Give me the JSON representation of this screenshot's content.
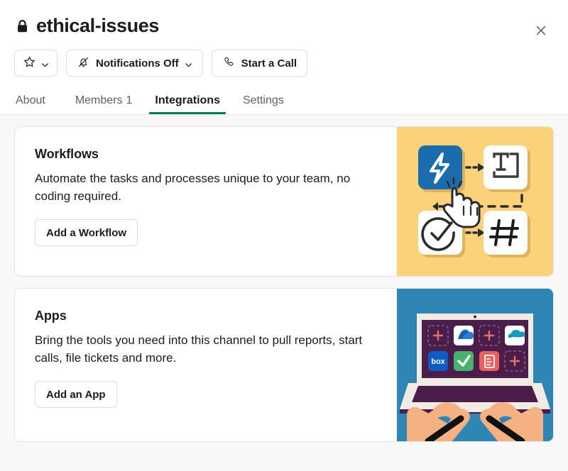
{
  "header": {
    "channel_name": "ethical-issues",
    "lock_icon": "lock-icon",
    "close_icon": "close-icon"
  },
  "toolbar": {
    "star_button": {
      "label": "",
      "icon": "star-icon",
      "chevron": "chevron-down-icon"
    },
    "notifications_button": {
      "label": "Notifications Off",
      "icon": "bell-muted-icon",
      "chevron": "chevron-down-icon"
    },
    "call_button": {
      "label": "Start a Call",
      "icon": "phone-icon"
    }
  },
  "tabs": [
    {
      "label": "About",
      "count": "",
      "active": false
    },
    {
      "label": "Members",
      "count": "1",
      "active": false
    },
    {
      "label": "Integrations",
      "count": "",
      "active": true
    },
    {
      "label": "Settings",
      "count": "",
      "active": false
    }
  ],
  "cards": [
    {
      "title": "Workflows",
      "description": "Automate the tasks and processes unique to your team, no coding required.",
      "button_label": "Add a Workflow",
      "art": "workflow-builder-illustration",
      "art_background": "#FBD17A",
      "art_tiles": [
        "lightning-bolt-icon",
        "text-form-icon",
        "check-circle-icon",
        "hashtag-icon"
      ],
      "art_cursor": "pointing-hand-cursor-icon"
    },
    {
      "title": "Apps",
      "description": "Bring the tools you need into this channel to pull reports, start calls, file tickets and more.",
      "button_label": "Add an App",
      "art": "laptop-apps-illustration",
      "art_background": "#2E86B5",
      "art_app_icons": [
        "plus-placeholder",
        "google-drive-icon",
        "plus-placeholder",
        "salesforce-icon",
        "box-icon",
        "green-check-icon",
        "ticket-icon",
        "plus-placeholder"
      ]
    }
  ],
  "colors": {
    "accent_green": "#007A5A",
    "workflow_yellow": "#FBD17A",
    "workflow_blue_tile": "#1A6CAD",
    "apps_blue": "#2E86B5",
    "laptop_purple": "#4B1D4B",
    "page_background": "#F8F8F8"
  }
}
